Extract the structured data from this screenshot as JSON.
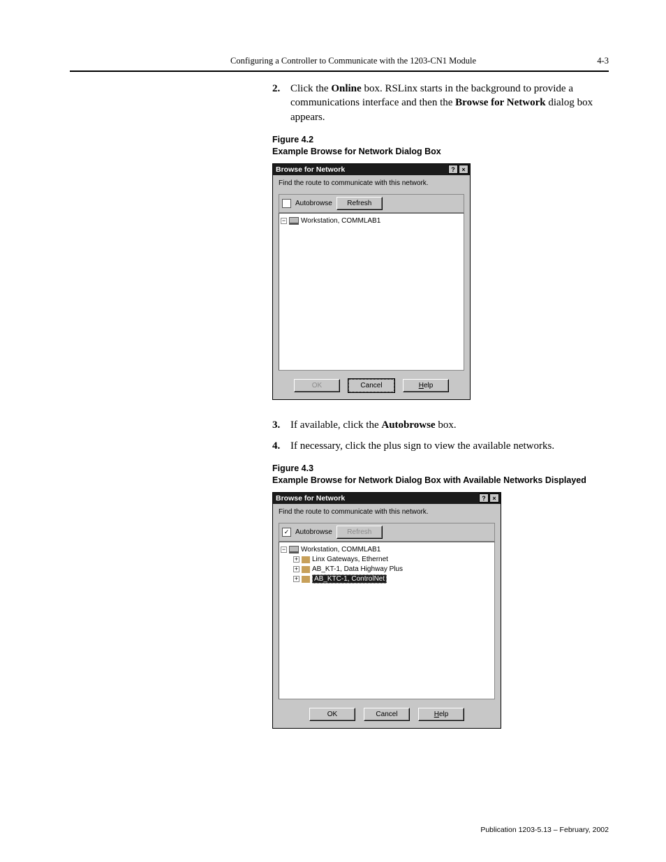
{
  "header": {
    "title": "Configuring a Controller to Communicate with the 1203-CN1 Module",
    "page_number": "4-3"
  },
  "step2": {
    "num": "2.",
    "text_before_bold1": "Click the ",
    "bold1": "Online",
    "text_mid": " box. RSLinx starts in the background to provide a communications interface and then the ",
    "bold2": "Browse for Network",
    "text_after": " dialog box appears."
  },
  "figure42": {
    "number": "Figure 4.2",
    "caption": "Example Browse for Network Dialog Box"
  },
  "dialog1": {
    "title": "Browse for Network",
    "help_glyph": "?",
    "close_glyph": "×",
    "instruction": "Find the route to communicate with this network.",
    "autobrowse_label": "Autobrowse",
    "refresh_label": "Refresh",
    "tree_root_expander": "−",
    "tree_root_label": "Workstation, COMMLAB1",
    "ok_label": "OK",
    "cancel_label": "Cancel",
    "help_label_u": "H",
    "help_label_rest": "elp"
  },
  "step3": {
    "num": "3.",
    "text_before": "If available, click the ",
    "bold": "Autobrowse",
    "text_after": " box."
  },
  "step4": {
    "num": "4.",
    "text": "If necessary, click the plus sign to view the available networks."
  },
  "figure43": {
    "number": "Figure 4.3",
    "caption": "Example Browse for Network Dialog Box with Available Networks Displayed"
  },
  "dialog2": {
    "title": "Browse for Network",
    "instruction": "Find the route to communicate with this network.",
    "autobrowse_label": "Autobrowse",
    "refresh_label": "Refresh",
    "tree": {
      "root_expander": "−",
      "root_label": "Workstation, COMMLAB1",
      "items": [
        {
          "expander": "+",
          "label": "Linx Gateways, Ethernet"
        },
        {
          "expander": "+",
          "label": "AB_KT-1, Data Highway Plus"
        },
        {
          "expander": "+",
          "label": "AB_KTC-1, ControlNet",
          "selected": true
        }
      ]
    },
    "ok_label": "OK",
    "cancel_label": "Cancel",
    "help_label_u": "H",
    "help_label_rest": "elp"
  },
  "footer": "Publication 1203-5.13 – February, 2002"
}
